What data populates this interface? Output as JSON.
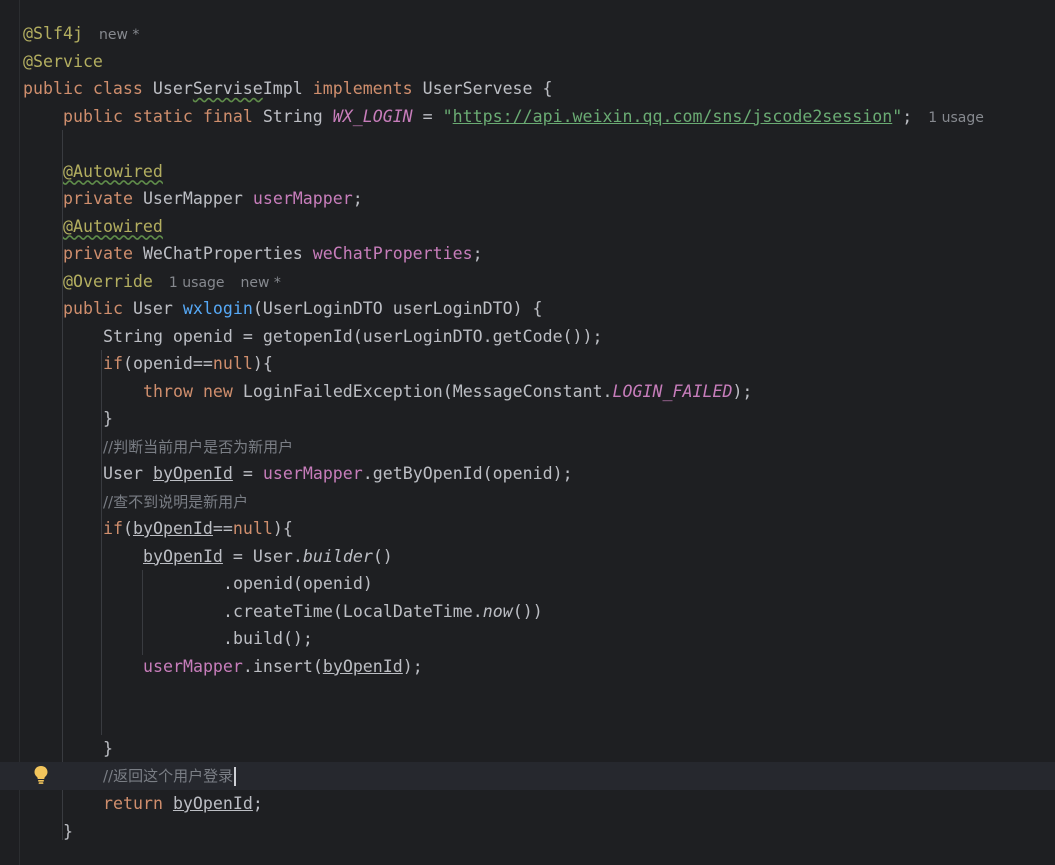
{
  "editor": {
    "language": "Java",
    "theme": {
      "background": "#1e1f22",
      "current_line": "#26282e",
      "keyword": "#cf8e6d",
      "annotation": "#b3ae60",
      "field": "#c77dbb",
      "string": "#6aab73",
      "method": "#56a8f5",
      "comment": "#7a7e85",
      "text": "#bcbec4"
    },
    "hints": {
      "new": "new *",
      "one_usage": "1 usage"
    },
    "gutter_icon": "lightbulb-icon",
    "lines": {
      "l1": "@Slf4j",
      "l2": "@Service",
      "l3_kw": "public class ",
      "l3_name_a": "User",
      "l3_name_b": "Servise",
      "l3_name_c": "Impl",
      "l3_impl": " implements ",
      "l3_iface": "UserServese {",
      "l4_kw": "public static final ",
      "l4_type": "String ",
      "l4_const": "WX_LOGIN",
      "l4_eq": " = ",
      "l4_q1": "\"",
      "l4_url": "https://api.weixin.qq.com/sns/jscode2session",
      "l4_q2": "\"",
      "l4_end": ";",
      "l6": "@Autowired",
      "l7_kw": "private ",
      "l7_type": "UserMapper ",
      "l7_field": "userMapper",
      "l7_end": ";",
      "l8": "@Autowired",
      "l9_kw": "private ",
      "l9_type": "WeChatProperties ",
      "l9_field": "weChatProperties",
      "l9_end": ";",
      "l10": "@Override",
      "l11_kw": "public ",
      "l11_type": "User ",
      "l11_fn": "wxlogin",
      "l11_rest": "(UserLoginDTO userLoginDTO) {",
      "l12": "String openid = getopenId(userLoginDTO.getCode());",
      "l13_kw": "if",
      "l13_a": "(openid==",
      "l13_null": "null",
      "l13_b": "){",
      "l14_kw": "throw new ",
      "l14_a": "LoginFailedException(MessageConstant.",
      "l14_const": "LOGIN_FAILED",
      "l14_b": ");",
      "l15": "}",
      "l16": "//判断当前用户是否为新用户",
      "l17_type": "User ",
      "l17_var": "byOpenId",
      "l17_eq": " = ",
      "l17_field": "userMapper",
      "l17_rest": ".getByOpenId(openid);",
      "l18": "//查不到说明是新用户",
      "l19_kw": "if",
      "l19_a": "(",
      "l19_var": "byOpenId",
      "l19_b": "==",
      "l19_null": "null",
      "l19_c": "){",
      "l20_var": "byOpenId",
      "l20_a": " = User.",
      "l20_fn": "builder",
      "l20_b": "()",
      "l21": ".openid(openid)",
      "l22_a": ".createTime(LocalDateTime.",
      "l22_fn": "now",
      "l22_b": "())",
      "l23": ".build();",
      "l24_field": "userMapper",
      "l24_a": ".insert(",
      "l24_var": "byOpenId",
      "l24_b": ");",
      "l27": "}",
      "l28": "//返回这个用户登录",
      "l29_kw": "return ",
      "l29_var": "byOpenId",
      "l29_end": ";",
      "l30": "}"
    }
  }
}
